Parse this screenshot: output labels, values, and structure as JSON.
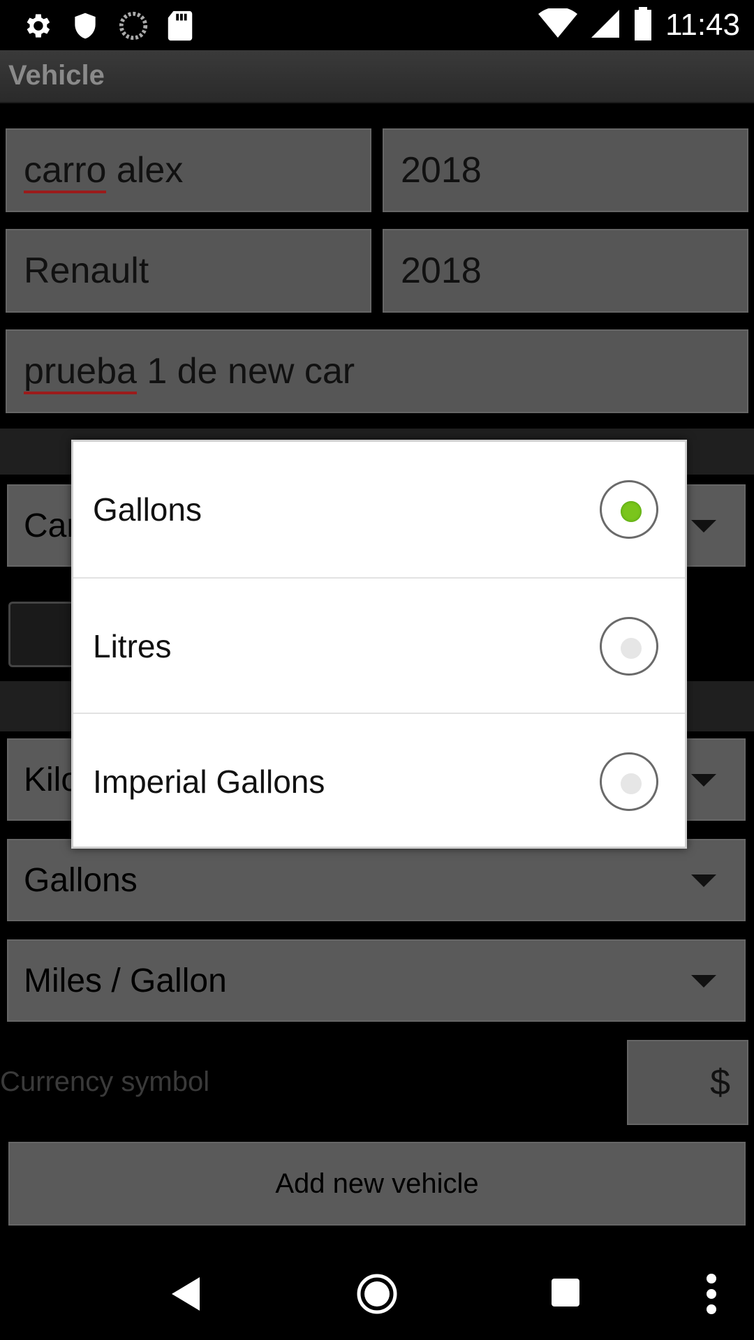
{
  "status_bar": {
    "time": "11:43",
    "left_icons": [
      "gear-icon",
      "shield-icon",
      "sync-icon",
      "sd-card-icon"
    ],
    "right_icons": [
      "wifi-icon",
      "signal-icon",
      "battery-icon"
    ]
  },
  "app_bar": {
    "title": "Vehicle"
  },
  "form": {
    "name": "carro alex",
    "year": "2018",
    "make": "Renault",
    "model": "2018",
    "notes": "prueba 1 de new car",
    "vehicle_type_partial": "Car",
    "distance_unit_partial": "Kilo",
    "volume_unit": "Gallons",
    "consumption_unit": "Miles / Gallon",
    "currency_label": "Currency symbol",
    "currency_value": "$",
    "add_button": "Add new vehicle"
  },
  "dialog": {
    "options": [
      {
        "label": "Gallons",
        "selected": true
      },
      {
        "label": "Litres",
        "selected": false
      },
      {
        "label": "Imperial Gallons",
        "selected": false
      }
    ],
    "accent_color": "#7ac51c"
  }
}
